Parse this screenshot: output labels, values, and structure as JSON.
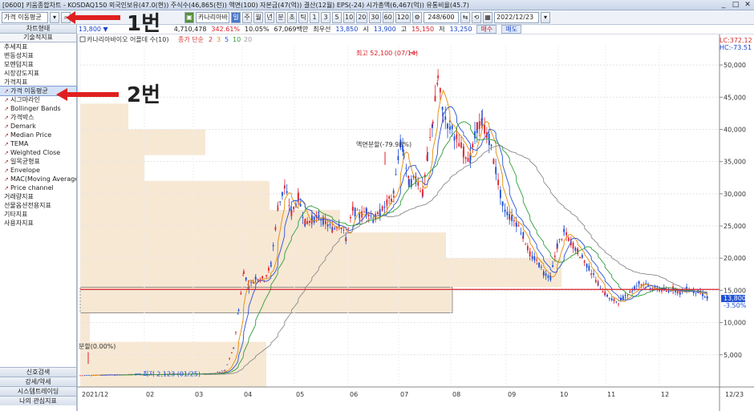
{
  "window": {
    "title": "[0600] 키움종합차트 - KOSDAQ150 외국인보유(47.0(현)) 주식수(46,865(천)) 액면(100) 자본금(47(억)) 결산(12월) EPS(-24) 시가총액(6,467(억)) 유통비율(45.7)",
    "buttons": [
      "_",
      "□",
      "✕"
    ]
  },
  "toolbar": {
    "search_value": "가격 이동평균",
    "stock_name": "카나리아바",
    "period_buttons": [
      "주",
      "월",
      "년",
      "분",
      "초",
      "틱"
    ],
    "interval_buttons": [
      "1",
      "3",
      "5",
      "10",
      "20",
      "30",
      "60",
      "120"
    ],
    "count": "248/600",
    "date": "2022/12/23"
  },
  "infobar": {
    "price": "13,800",
    "change_arrow": "▼",
    "volume": "4,710,478",
    "pct": "342.61%",
    "rate": "10.05%",
    "amount": "67,069백만",
    "quote_label": "최우선",
    "quote": "13,850",
    "high_label": "시",
    "open": "13,900",
    "high_label2": "고",
    "high": "15,150",
    "low_label": "저",
    "low": "13,250",
    "buy": "매수",
    "sell": "매도"
  },
  "sidebar": {
    "top_tab": "차트형태",
    "second_tab": "기술적지표",
    "items": [
      {
        "label": "추세지표",
        "sub": false
      },
      {
        "label": "변동성지표",
        "sub": false
      },
      {
        "label": "모멘텀지표",
        "sub": false
      },
      {
        "label": "시장강도지표",
        "sub": false
      },
      {
        "label": "가격지표",
        "sub": false
      },
      {
        "label": "가격 이동평균",
        "sub": true
      },
      {
        "label": "시그마라인",
        "sub": true
      },
      {
        "label": "Bollinger Bands",
        "sub": true
      },
      {
        "label": "가격박스",
        "sub": true
      },
      {
        "label": "Demark",
        "sub": true
      },
      {
        "label": "Median Price",
        "sub": true
      },
      {
        "label": "TEMA",
        "sub": true
      },
      {
        "label": "Weighted Close",
        "sub": true
      },
      {
        "label": "일목균형표",
        "sub": true
      },
      {
        "label": "Envelope",
        "sub": true
      },
      {
        "label": "MAC(Moving Average",
        "sub": true
      },
      {
        "label": "Price channel",
        "sub": true
      },
      {
        "label": "거래량지표",
        "sub": false
      },
      {
        "label": "선물옵션전용지표",
        "sub": false
      },
      {
        "label": "기타지표",
        "sub": false
      },
      {
        "label": "사용자지표",
        "sub": false
      }
    ],
    "bottom_tabs": [
      "신호검색",
      "강세/약세",
      "시스템트레이딩",
      "나의 관심지표"
    ]
  },
  "annotations": {
    "label1": "1번",
    "label2": "2번"
  },
  "chart_header": {
    "stock": "카나리아바이오 어플데 수(10)",
    "ma_label": "종가 단순",
    "ma_periods": [
      "2",
      "3",
      "5",
      "10",
      "20"
    ],
    "ma_colors": [
      "#d03030",
      "#e08a00",
      "#2a50d8",
      "#2e9e3a",
      "#9a9a9a"
    ]
  },
  "chart_data": {
    "type": "candlestick",
    "x_ticks": [
      "2021/12",
      "02",
      "03",
      "04",
      "05",
      "06",
      "07",
      "08",
      "09",
      "10",
      "11",
      "12",
      "12/23"
    ],
    "y_ticks": [
      5000,
      10000,
      15000,
      20000,
      25000,
      30000,
      35000,
      40000,
      45000,
      50000
    ],
    "y_tick_labels": [
      "5,000",
      "10,000",
      "15,000",
      "20,000",
      "25,000",
      "30,000",
      "35,000",
      "40,000",
      "45,000",
      "50,000"
    ],
    "ylim": [
      0,
      53000
    ],
    "price_series": [
      [
        0,
        1800
      ],
      [
        8,
        1850
      ],
      [
        15,
        1900
      ],
      [
        22,
        1870
      ],
      [
        30,
        1950
      ],
      [
        40,
        1920
      ],
      [
        50,
        1980
      ],
      [
        60,
        2000
      ],
      [
        70,
        2050
      ],
      [
        78,
        2100
      ],
      [
        85,
        2600
      ],
      [
        90,
        6000
      ],
      [
        93,
        12000
      ],
      [
        96,
        18000
      ],
      [
        99,
        15500
      ],
      [
        103,
        17000
      ],
      [
        108,
        16800
      ],
      [
        112,
        19000
      ],
      [
        116,
        28000
      ],
      [
        120,
        31000
      ],
      [
        124,
        27000
      ],
      [
        128,
        29500
      ],
      [
        132,
        25500
      ],
      [
        136,
        26000
      ],
      [
        140,
        26500
      ],
      [
        144,
        25500
      ],
      [
        148,
        24500
      ],
      [
        152,
        25500
      ],
      [
        156,
        23000
      ],
      [
        160,
        27500
      ],
      [
        164,
        26500
      ],
      [
        168,
        27500
      ],
      [
        172,
        26000
      ],
      [
        176,
        27000
      ],
      [
        180,
        28500
      ],
      [
        184,
        30000
      ],
      [
        188,
        38000
      ],
      [
        190,
        36000
      ],
      [
        193,
        31500
      ],
      [
        197,
        32500
      ],
      [
        201,
        30000
      ],
      [
        204,
        36000
      ],
      [
        207,
        41500
      ],
      [
        210,
        48000
      ],
      [
        213,
        42000
      ],
      [
        217,
        40500
      ],
      [
        221,
        38500
      ],
      [
        225,
        36500
      ],
      [
        229,
        35500
      ],
      [
        233,
        40500
      ],
      [
        236,
        41000
      ],
      [
        240,
        38500
      ],
      [
        244,
        33500
      ],
      [
        248,
        28000
      ],
      [
        252,
        26500
      ],
      [
        256,
        25500
      ],
      [
        260,
        23500
      ],
      [
        264,
        20500
      ],
      [
        268,
        19500
      ],
      [
        272,
        17800
      ],
      [
        276,
        17000
      ],
      [
        280,
        22000
      ],
      [
        284,
        24000
      ],
      [
        288,
        22500
      ],
      [
        292,
        21000
      ],
      [
        296,
        19500
      ],
      [
        300,
        17800
      ],
      [
        304,
        16000
      ],
      [
        308,
        14500
      ],
      [
        312,
        13500
      ],
      [
        316,
        13200
      ],
      [
        320,
        14200
      ],
      [
        324,
        15000
      ],
      [
        328,
        16200
      ],
      [
        332,
        15800
      ],
      [
        336,
        15200
      ],
      [
        340,
        15200
      ],
      [
        344,
        14900
      ],
      [
        348,
        15300
      ],
      [
        352,
        14600
      ],
      [
        356,
        15200
      ],
      [
        360,
        14900
      ],
      [
        364,
        14600
      ],
      [
        368,
        13800
      ]
    ],
    "n_days": 370,
    "hline": 15150,
    "hline2": 13800,
    "current_price_label": "13,800",
    "current_pct_label": "-3.50%",
    "max_label": "최고 52,100 (07/14)",
    "min_label": "최저 2,123 (01/25)",
    "split_label": "액면분할(-79.98%)",
    "lc_label": "LC:372.12",
    "hc_label": "HC:-73.51",
    "left_label": "분할(0.00%)",
    "volume_profile": [
      {
        "price_low": 0,
        "price_high": 2000,
        "volume": 290
      },
      {
        "price_low": 2000,
        "price_high": 7000,
        "volume": 290
      },
      {
        "price_low": 7000,
        "price_high": 11500,
        "volume": 15
      },
      {
        "price_low": 11500,
        "price_high": 15500,
        "volume": 580
      },
      {
        "price_low": 15500,
        "price_high": 20000,
        "volume": 750
      },
      {
        "price_low": 20000,
        "price_high": 24000,
        "volume": 570
      },
      {
        "price_low": 24000,
        "price_high": 27500,
        "volume": 405
      },
      {
        "price_low": 27500,
        "price_high": 32000,
        "volume": 295
      },
      {
        "price_low": 32000,
        "price_high": 36000,
        "volume": 100
      },
      {
        "price_low": 36000,
        "price_high": 40000,
        "volume": 195
      },
      {
        "price_low": 40000,
        "price_high": 44000,
        "volume": 75
      }
    ]
  }
}
